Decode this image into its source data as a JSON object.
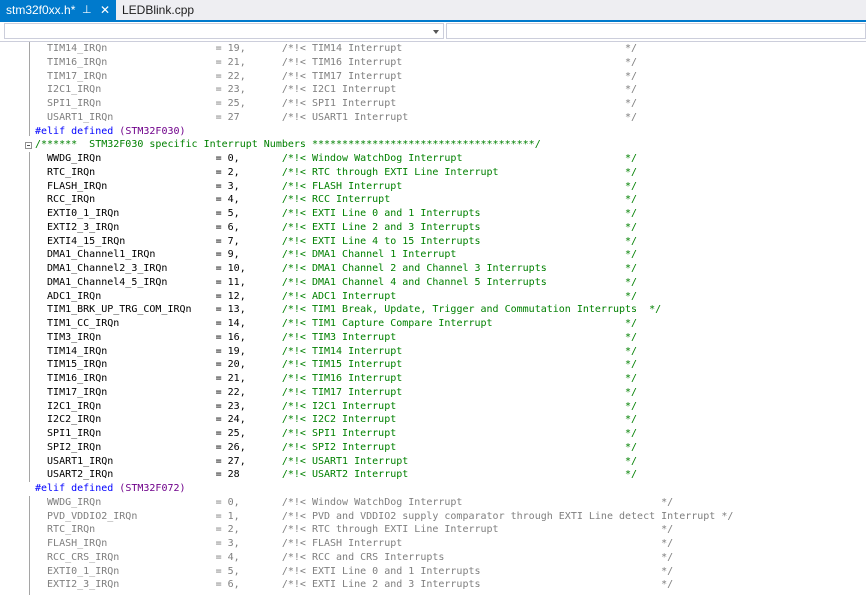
{
  "tabs": [
    {
      "label": "stm32f0xx.h*",
      "pin": "⊥",
      "close": "✕"
    },
    {
      "label": "LEDBlink.cpp"
    }
  ],
  "lines": [
    {
      "i": true,
      "t": "  TIM14_IRQn                  = 19,      /*!< TIM14 Interrupt                                     */"
    },
    {
      "i": true,
      "t": "  TIM16_IRQn                  = 21,      /*!< TIM16 Interrupt                                     */"
    },
    {
      "i": true,
      "t": "  TIM17_IRQn                  = 22,      /*!< TIM17 Interrupt                                     */"
    },
    {
      "i": true,
      "t": "  I2C1_IRQn                   = 23,      /*!< I2C1 Interrupt                                      */"
    },
    {
      "i": true,
      "t": "  SPI1_IRQn                   = 25,      /*!< SPI1 Interrupt                                      */"
    },
    {
      "i": true,
      "t": "  USART1_IRQn                 = 27       /*!< USART1 Interrupt                                    */"
    },
    {
      "d": true,
      "kw": "#elif defined ",
      "mac": "(STM32F030)"
    },
    {
      "c": true,
      "t": "/******  STM32F030 specific Interrupt Numbers *************************************/"
    },
    {
      "n": "  WWDG_IRQn                   = 0,       ",
      "c": "/*!< Window WatchDog Interrupt                           */"
    },
    {
      "n": "  RTC_IRQn                    = 2,       ",
      "c": "/*!< RTC through EXTI Line Interrupt                     */"
    },
    {
      "n": "  FLASH_IRQn                  = 3,       ",
      "c": "/*!< FLASH Interrupt                                     */"
    },
    {
      "n": "  RCC_IRQn                    = 4,       ",
      "c": "/*!< RCC Interrupt                                       */"
    },
    {
      "n": "  EXTI0_1_IRQn                = 5,       ",
      "c": "/*!< EXTI Line 0 and 1 Interrupts                        */"
    },
    {
      "n": "  EXTI2_3_IRQn                = 6,       ",
      "c": "/*!< EXTI Line 2 and 3 Interrupts                        */"
    },
    {
      "n": "  EXTI4_15_IRQn               = 7,       ",
      "c": "/*!< EXTI Line 4 to 15 Interrupts                        */"
    },
    {
      "n": "  DMA1_Channel1_IRQn          = 9,       ",
      "c": "/*!< DMA1 Channel 1 Interrupt                            */"
    },
    {
      "n": "  DMA1_Channel2_3_IRQn        = 10,      ",
      "c": "/*!< DMA1 Channel 2 and Channel 3 Interrupts             */"
    },
    {
      "n": "  DMA1_Channel4_5_IRQn        = 11,      ",
      "c": "/*!< DMA1 Channel 4 and Channel 5 Interrupts             */"
    },
    {
      "n": "  ADC1_IRQn                   = 12,      ",
      "c": "/*!< ADC1 Interrupt                                      */"
    },
    {
      "n": "  TIM1_BRK_UP_TRG_COM_IRQn    = 13,      ",
      "c": "/*!< TIM1 Break, Update, Trigger and Commutation Interrupts  */"
    },
    {
      "n": "  TIM1_CC_IRQn                = 14,      ",
      "c": "/*!< TIM1 Capture Compare Interrupt                      */"
    },
    {
      "n": "  TIM3_IRQn                   = 16,      ",
      "c": "/*!< TIM3 Interrupt                                      */"
    },
    {
      "n": "  TIM14_IRQn                  = 19,      ",
      "c": "/*!< TIM14 Interrupt                                     */"
    },
    {
      "n": "  TIM15_IRQn                  = 20,      ",
      "c": "/*!< TIM15 Interrupt                                     */"
    },
    {
      "n": "  TIM16_IRQn                  = 21,      ",
      "c": "/*!< TIM16 Interrupt                                     */"
    },
    {
      "n": "  TIM17_IRQn                  = 22,      ",
      "c": "/*!< TIM17 Interrupt                                     */"
    },
    {
      "n": "  I2C1_IRQn                   = 23,      ",
      "c": "/*!< I2C1 Interrupt                                      */"
    },
    {
      "n": "  I2C2_IRQn                   = 24,      ",
      "c": "/*!< I2C2 Interrupt                                      */"
    },
    {
      "n": "  SPI1_IRQn                   = 25,      ",
      "c": "/*!< SPI1 Interrupt                                      */"
    },
    {
      "n": "  SPI2_IRQn                   = 26,      ",
      "c": "/*!< SPI2 Interrupt                                      */"
    },
    {
      "n": "  USART1_IRQn                 = 27,      ",
      "c": "/*!< USART1 Interrupt                                    */"
    },
    {
      "n": "  USART2_IRQn                 = 28       ",
      "c": "/*!< USART2 Interrupt                                    */"
    },
    {
      "d": true,
      "kw": "#elif defined ",
      "mac": "(STM32F072)"
    },
    {
      "i": true,
      "t": "  WWDG_IRQn                   = 0,       /*!< Window WatchDog Interrupt                                 */"
    },
    {
      "i": true,
      "t": "  PVD_VDDIO2_IRQn             = 1,       /*!< PVD and VDDIO2 supply comparator through EXTI Line detect Interrupt */"
    },
    {
      "i": true,
      "t": "  RTC_IRQn                    = 2,       /*!< RTC through EXTI Line Interrupt                           */"
    },
    {
      "i": true,
      "t": "  FLASH_IRQn                  = 3,       /*!< FLASH Interrupt                                           */"
    },
    {
      "i": true,
      "t": "  RCC_CRS_IRQn                = 4,       /*!< RCC and CRS Interrupts                                    */"
    },
    {
      "i": true,
      "t": "  EXTI0_1_IRQn                = 5,       /*!< EXTI Line 0 and 1 Interrupts                              */"
    },
    {
      "i": true,
      "t": "  EXTI2_3_IRQn                = 6,       /*!< EXTI Line 2 and 3 Interrupts                              */"
    }
  ]
}
